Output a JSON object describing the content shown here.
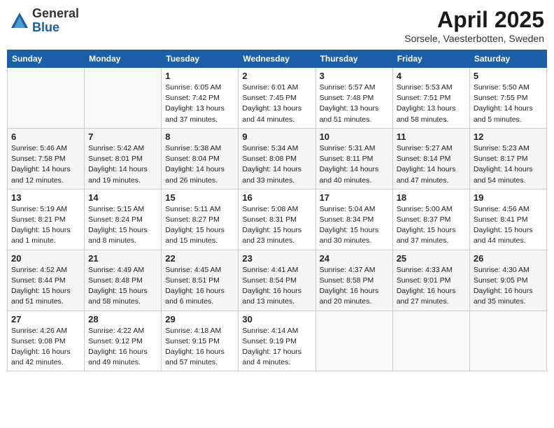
{
  "header": {
    "logo_general": "General",
    "logo_blue": "Blue",
    "month_year": "April 2025",
    "location": "Sorsele, Vaesterbotten, Sweden"
  },
  "days_of_week": [
    "Sunday",
    "Monday",
    "Tuesday",
    "Wednesday",
    "Thursday",
    "Friday",
    "Saturday"
  ],
  "weeks": [
    [
      {
        "day": "",
        "info": ""
      },
      {
        "day": "",
        "info": ""
      },
      {
        "day": "1",
        "info": "Sunrise: 6:05 AM\nSunset: 7:42 PM\nDaylight: 13 hours\nand 37 minutes."
      },
      {
        "day": "2",
        "info": "Sunrise: 6:01 AM\nSunset: 7:45 PM\nDaylight: 13 hours\nand 44 minutes."
      },
      {
        "day": "3",
        "info": "Sunrise: 5:57 AM\nSunset: 7:48 PM\nDaylight: 13 hours\nand 51 minutes."
      },
      {
        "day": "4",
        "info": "Sunrise: 5:53 AM\nSunset: 7:51 PM\nDaylight: 13 hours\nand 58 minutes."
      },
      {
        "day": "5",
        "info": "Sunrise: 5:50 AM\nSunset: 7:55 PM\nDaylight: 14 hours\nand 5 minutes."
      }
    ],
    [
      {
        "day": "6",
        "info": "Sunrise: 5:46 AM\nSunset: 7:58 PM\nDaylight: 14 hours\nand 12 minutes."
      },
      {
        "day": "7",
        "info": "Sunrise: 5:42 AM\nSunset: 8:01 PM\nDaylight: 14 hours\nand 19 minutes."
      },
      {
        "day": "8",
        "info": "Sunrise: 5:38 AM\nSunset: 8:04 PM\nDaylight: 14 hours\nand 26 minutes."
      },
      {
        "day": "9",
        "info": "Sunrise: 5:34 AM\nSunset: 8:08 PM\nDaylight: 14 hours\nand 33 minutes."
      },
      {
        "day": "10",
        "info": "Sunrise: 5:31 AM\nSunset: 8:11 PM\nDaylight: 14 hours\nand 40 minutes."
      },
      {
        "day": "11",
        "info": "Sunrise: 5:27 AM\nSunset: 8:14 PM\nDaylight: 14 hours\nand 47 minutes."
      },
      {
        "day": "12",
        "info": "Sunrise: 5:23 AM\nSunset: 8:17 PM\nDaylight: 14 hours\nand 54 minutes."
      }
    ],
    [
      {
        "day": "13",
        "info": "Sunrise: 5:19 AM\nSunset: 8:21 PM\nDaylight: 15 hours\nand 1 minute."
      },
      {
        "day": "14",
        "info": "Sunrise: 5:15 AM\nSunset: 8:24 PM\nDaylight: 15 hours\nand 8 minutes."
      },
      {
        "day": "15",
        "info": "Sunrise: 5:11 AM\nSunset: 8:27 PM\nDaylight: 15 hours\nand 15 minutes."
      },
      {
        "day": "16",
        "info": "Sunrise: 5:08 AM\nSunset: 8:31 PM\nDaylight: 15 hours\nand 23 minutes."
      },
      {
        "day": "17",
        "info": "Sunrise: 5:04 AM\nSunset: 8:34 PM\nDaylight: 15 hours\nand 30 minutes."
      },
      {
        "day": "18",
        "info": "Sunrise: 5:00 AM\nSunset: 8:37 PM\nDaylight: 15 hours\nand 37 minutes."
      },
      {
        "day": "19",
        "info": "Sunrise: 4:56 AM\nSunset: 8:41 PM\nDaylight: 15 hours\nand 44 minutes."
      }
    ],
    [
      {
        "day": "20",
        "info": "Sunrise: 4:52 AM\nSunset: 8:44 PM\nDaylight: 15 hours\nand 51 minutes."
      },
      {
        "day": "21",
        "info": "Sunrise: 4:49 AM\nSunset: 8:48 PM\nDaylight: 15 hours\nand 58 minutes."
      },
      {
        "day": "22",
        "info": "Sunrise: 4:45 AM\nSunset: 8:51 PM\nDaylight: 16 hours\nand 6 minutes."
      },
      {
        "day": "23",
        "info": "Sunrise: 4:41 AM\nSunset: 8:54 PM\nDaylight: 16 hours\nand 13 minutes."
      },
      {
        "day": "24",
        "info": "Sunrise: 4:37 AM\nSunset: 8:58 PM\nDaylight: 16 hours\nand 20 minutes."
      },
      {
        "day": "25",
        "info": "Sunrise: 4:33 AM\nSunset: 9:01 PM\nDaylight: 16 hours\nand 27 minutes."
      },
      {
        "day": "26",
        "info": "Sunrise: 4:30 AM\nSunset: 9:05 PM\nDaylight: 16 hours\nand 35 minutes."
      }
    ],
    [
      {
        "day": "27",
        "info": "Sunrise: 4:26 AM\nSunset: 9:08 PM\nDaylight: 16 hours\nand 42 minutes."
      },
      {
        "day": "28",
        "info": "Sunrise: 4:22 AM\nSunset: 9:12 PM\nDaylight: 16 hours\nand 49 minutes."
      },
      {
        "day": "29",
        "info": "Sunrise: 4:18 AM\nSunset: 9:15 PM\nDaylight: 16 hours\nand 57 minutes."
      },
      {
        "day": "30",
        "info": "Sunrise: 4:14 AM\nSunset: 9:19 PM\nDaylight: 17 hours\nand 4 minutes."
      },
      {
        "day": "",
        "info": ""
      },
      {
        "day": "",
        "info": ""
      },
      {
        "day": "",
        "info": ""
      }
    ]
  ]
}
